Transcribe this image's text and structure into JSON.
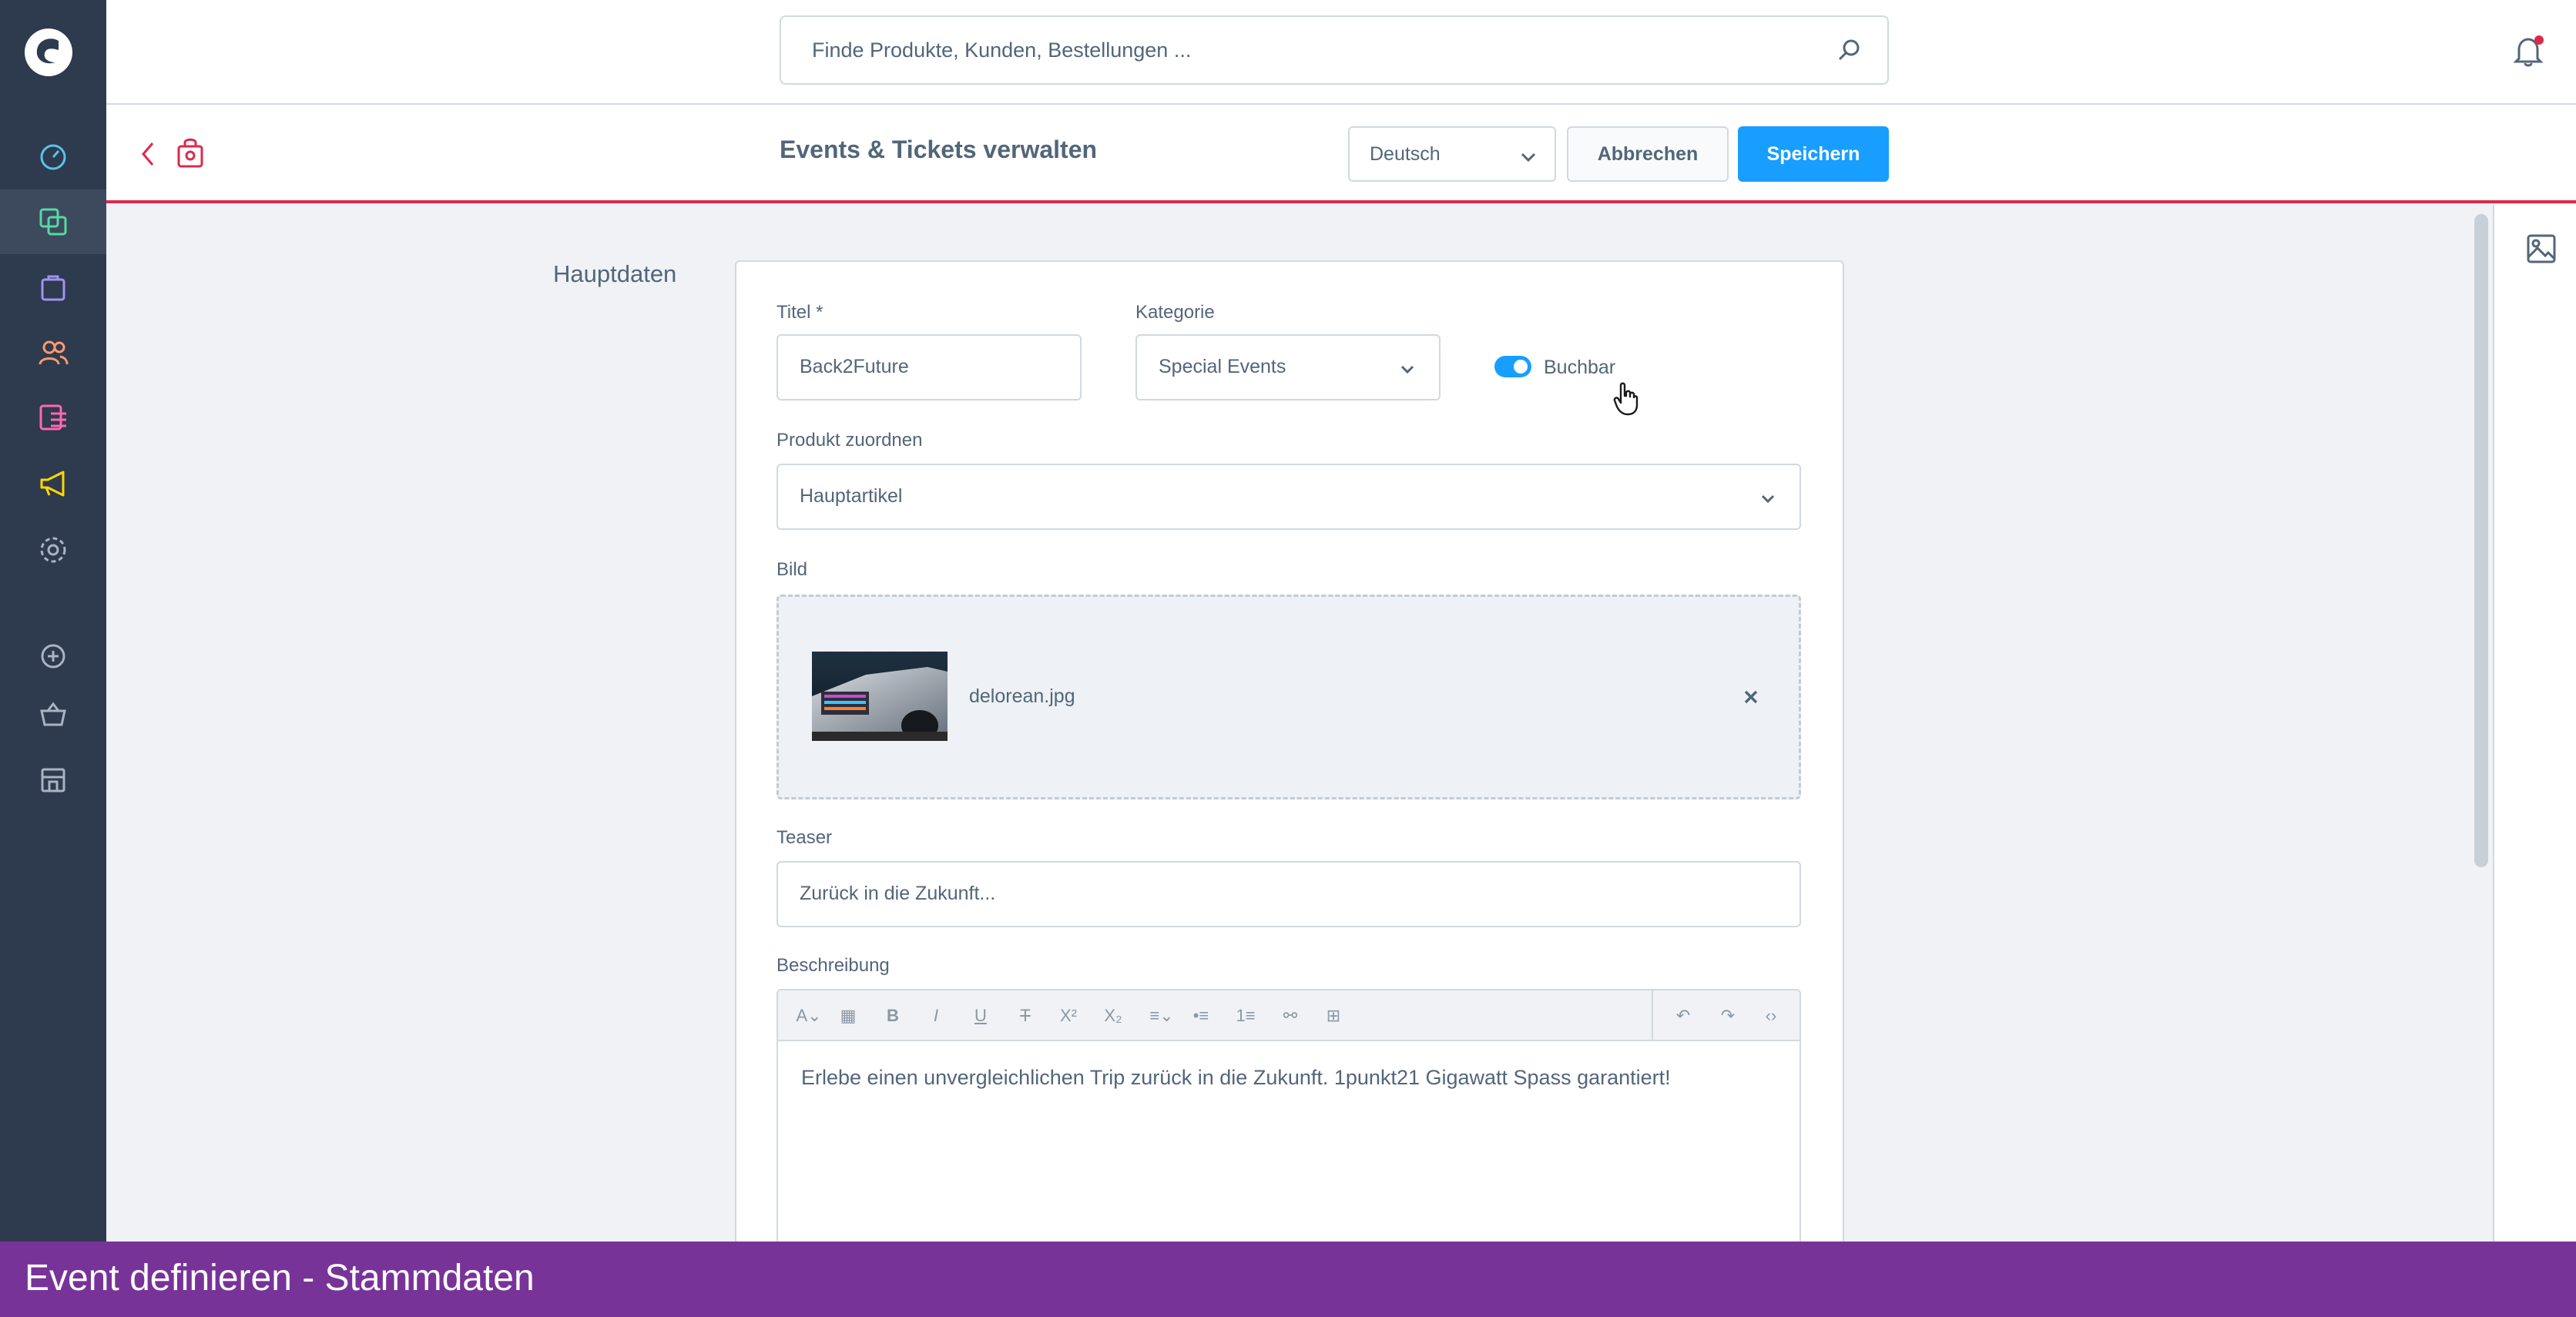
{
  "search": {
    "placeholder": "Finde Produkte, Kunden, Bestellungen ..."
  },
  "header": {
    "title": "Events & Tickets verwalten",
    "language": "Deutsch",
    "cancel_label": "Abbrechen",
    "save_label": "Speichern"
  },
  "section": {
    "label": "Hauptdaten"
  },
  "form": {
    "title_label": "Titel *",
    "title_value": "Back2Future",
    "category_label": "Kategorie",
    "category_value": "Special Events",
    "bookable_label": "Buchbar",
    "bookable_on": true,
    "product_label": "Produkt zuordnen",
    "product_value": "Hauptartikel",
    "image_label": "Bild",
    "image_file": "delorean.jpg",
    "teaser_label": "Teaser",
    "teaser_value": "Zurück in die Zukunft...",
    "description_label": "Beschreibung",
    "description_text": "Erlebe einen unvergleichlichen Trip zurück in die Zukunft. 1punkt21 Gigawatt Spass garantiert!"
  },
  "editor_toolbar": [
    "format-icon",
    "clear-format-icon",
    "bold-icon",
    "italic-icon",
    "underline-icon",
    "strikethrough-icon",
    "superscript-icon",
    "subscript-icon",
    "align-icon",
    "bullet-list-icon",
    "numbered-list-icon",
    "link-icon",
    "table-icon",
    "undo-icon",
    "redo-icon",
    "code-icon"
  ],
  "sidebar": [
    "dashboard-icon",
    "catalog-icon",
    "orders-icon",
    "customers-icon",
    "content-icon",
    "marketing-icon",
    "settings-icon",
    "add-icon",
    "basket-icon",
    "store-icon"
  ],
  "caption": "Event definieren - Stammdaten",
  "colors": {
    "sidebar": "#2e3a4d",
    "primary": "#189eff",
    "accent_red": "#de294c",
    "caption": "#783399"
  }
}
